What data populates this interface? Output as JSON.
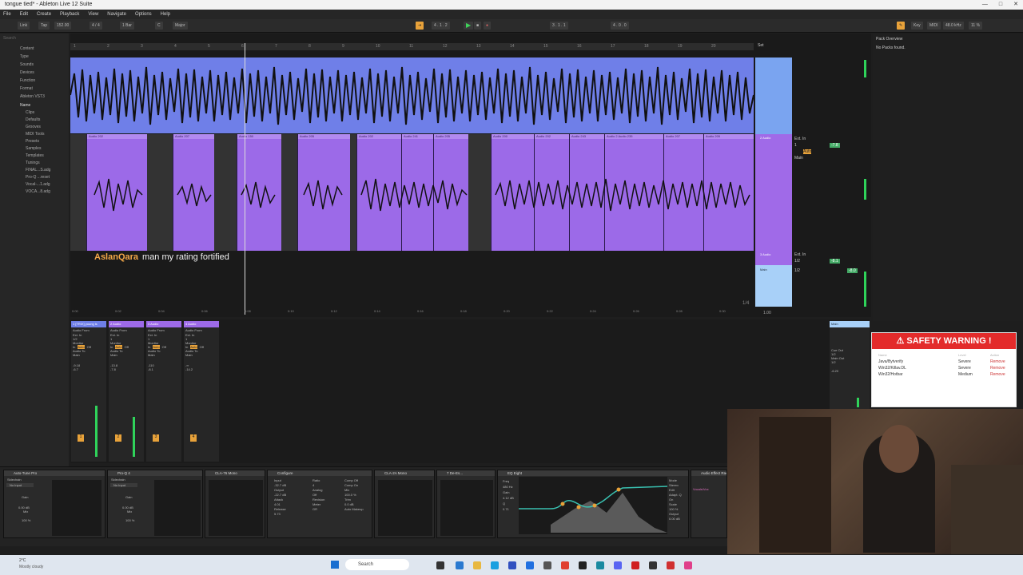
{
  "window": {
    "title": "tongue tied* - Ableton Live 12 Suite",
    "controls": [
      "—",
      "□",
      "✕"
    ]
  },
  "menu": [
    "File",
    "Edit",
    "Create",
    "Playback",
    "View",
    "Navigate",
    "Options",
    "Help"
  ],
  "transport": {
    "link": "Link",
    "tap": "Tap",
    "tempo": "152.00",
    "time_sig": "4 / 4",
    "quantize": "1 Bar",
    "scale_root": "C",
    "scale_mode": "Major",
    "position": "4 . 1 . 2",
    "loop_start": "3 . 1 . 1",
    "loop_length": "4 . 0 . 0",
    "key_label": "Key",
    "midi_label": "MIDI",
    "sample_rate": "48.0 kHz",
    "cpu": "11 %"
  },
  "browser": {
    "search_placeholder": "Search",
    "sections": [
      "Content",
      "Type",
      "Sounds",
      "Devices",
      "Function",
      "Format",
      "Ableton VST3"
    ],
    "name_header": "Name",
    "items": [
      "Clips",
      "Defaults",
      "Grooves",
      "MIDI Tools",
      "Presets",
      "Samples",
      "Templates",
      "Tunings",
      "FINAL...S.adg",
      "Pro-Q ...reset",
      "Vocal-...1.adg",
      "VOCA...8.adg"
    ]
  },
  "arrangement": {
    "bar_numbers": [
      "1",
      "2",
      "3",
      "4",
      "5",
      "6",
      "7",
      "8",
      "9",
      "10",
      "11",
      "12",
      "13",
      "14",
      "15",
      "16",
      "17",
      "18",
      "19",
      "20"
    ],
    "time_labels": [
      "0:00",
      "0:02",
      "0:04",
      "0:06",
      "0:08",
      "0:10",
      "0:12",
      "0:14",
      "0:16",
      "0:18",
      "0:20",
      "0:22",
      "0:24",
      "0:26",
      "0:28",
      "0:30"
    ],
    "clips": [
      "Audio 202",
      "Audio 207",
      "Audio 150",
      "Audio 205",
      "Audio 202",
      "Audio 241",
      "Audio 205",
      "Audio 200",
      "Audio 202",
      "Audio 243",
      "Audio 2 Audio 235",
      "Audio 207",
      "Audio 209"
    ],
    "grid": "1/4",
    "set_label": "Set",
    "tracks": [
      {
        "name": "2 Audio",
        "input": "Ext. In",
        "channel": "1",
        "monitor": "Auto",
        "out": "Main",
        "volume": "-7.8",
        "color": "#a06ae8"
      },
      {
        "name": "3 Audio",
        "input": "Ext. In",
        "channel": "1/2",
        "monitor": "Auto",
        "out": "Main",
        "volume": "-8.1",
        "color": "#a06ae8"
      },
      {
        "name": "Main",
        "channel": "1/2",
        "volume": "-8.0",
        "color": "#a8d0f8"
      }
    ],
    "zoom": "1.00"
  },
  "chat_caption": {
    "user": "AslanQara",
    "message": "man my rating fortified"
  },
  "packs": {
    "title": "Pack Overview",
    "status": "No Packs found."
  },
  "mixer": {
    "strips": [
      {
        "name": "1 [TRIX] young is",
        "input": "Ext. In",
        "ch": "1/2",
        "out": "Main",
        "peak": "-9.18",
        "vol": "-6.7",
        "num": "1"
      },
      {
        "name": "2 Audio",
        "input": "Ext. In",
        "ch": "1",
        "out": "Main",
        "peak": "-13.8",
        "vol": "-7.8",
        "num": "2"
      },
      {
        "name": "3 Audio",
        "input": "Ext. In",
        "ch": "1",
        "out": "Main",
        "peak": "-110",
        "vol": "-8.1",
        "num": "3"
      },
      {
        "name": "4 Audio",
        "input": "Ext. In",
        "ch": "1",
        "out": "Main",
        "peak": "-∞",
        "vol": "-14.2",
        "num": "4"
      }
    ],
    "labels": {
      "audio_from": "Audio From",
      "monitor": "Monitor",
      "audio_to": "Audio To",
      "in": "In",
      "auto": "Auto",
      "off": "Off"
    },
    "main": {
      "name": "Main",
      "cue_out": "Cue Out",
      "cue_ch": "1/2",
      "main_out": "Main Out",
      "main_ch": "1/2",
      "vol": "-6.20"
    }
  },
  "devices": [
    {
      "name": "Auto-Tune Pro",
      "sidechain": "Sidechain",
      "input": "No Input",
      "gain": "Gain",
      "gain_val": "0.00 dB",
      "mix": "Mix",
      "mix_val": "100 %"
    },
    {
      "name": "Pro-Q 4",
      "sidechain": "Sidechain",
      "input": "No Input",
      "gain": "Gain",
      "gain_val": "0.00 dB",
      "mix": "Mix",
      "mix_val": "100 %"
    },
    {
      "name": "CLA-76 Mono"
    },
    {
      "name": "Configure",
      "params": [
        [
          "Input",
          "-32.7 dB"
        ],
        [
          "Output",
          "-22.7 dB"
        ],
        [
          "Attack",
          "4.01"
        ],
        [
          "Release",
          "5.73"
        ],
        [
          "Ratio",
          "4"
        ],
        [
          "Analog",
          "Off"
        ],
        [
          "Revision",
          "Bluey"
        ],
        [
          "Meter",
          "GR"
        ],
        [
          "Comp Off",
          ""
        ],
        [
          "Comp On",
          ""
        ],
        [
          "Mix",
          "100.0 %"
        ],
        [
          "Trim",
          "0.0 dB"
        ],
        [
          "Auto Makeup",
          ""
        ]
      ]
    },
    {
      "name": "CLA-2A Mono"
    },
    {
      "name": "7 De-Es..."
    },
    {
      "name": "EQ Eight",
      "freq": "Freq",
      "freq_val": "480 Hz",
      "gain": "Gain",
      "gain_val": "4.12 dB",
      "q": "Q",
      "q_val": "0.71",
      "mode": "Mode",
      "mode_val": "Stereo",
      "edit": "Edit",
      "adapt": "Adapt. Q",
      "adapt_val": "On",
      "scale": "Scale",
      "scale_val": "100 %",
      "output": "Output",
      "output_val": "0.00 dB"
    },
    {
      "name": "Audio Effect Rack",
      "chain": "Vocals/Vox"
    }
  ],
  "safety_warning": {
    "title": "SAFETY WARNING !",
    "headers": [
      "Name",
      "Level",
      "Action"
    ],
    "rows": [
      {
        "name": "Java/Bytverify",
        "level": "Severe",
        "action": "Remove"
      },
      {
        "name": "Win32/Killav.DL",
        "level": "Severe",
        "action": "Remove"
      },
      {
        "name": "Win32/Hotbar",
        "level": "Medium",
        "action": "Remove"
      }
    ]
  },
  "taskbar": {
    "weather_temp": "2°C",
    "weather_desc": "Mostly cloudy",
    "search": "Search"
  },
  "colors": {
    "blue_track": "#6f7fe8",
    "purple_track": "#9c6ae8",
    "main_track": "#a8d0f8",
    "accent": "#f4a848",
    "warn": "#e32b2b"
  }
}
